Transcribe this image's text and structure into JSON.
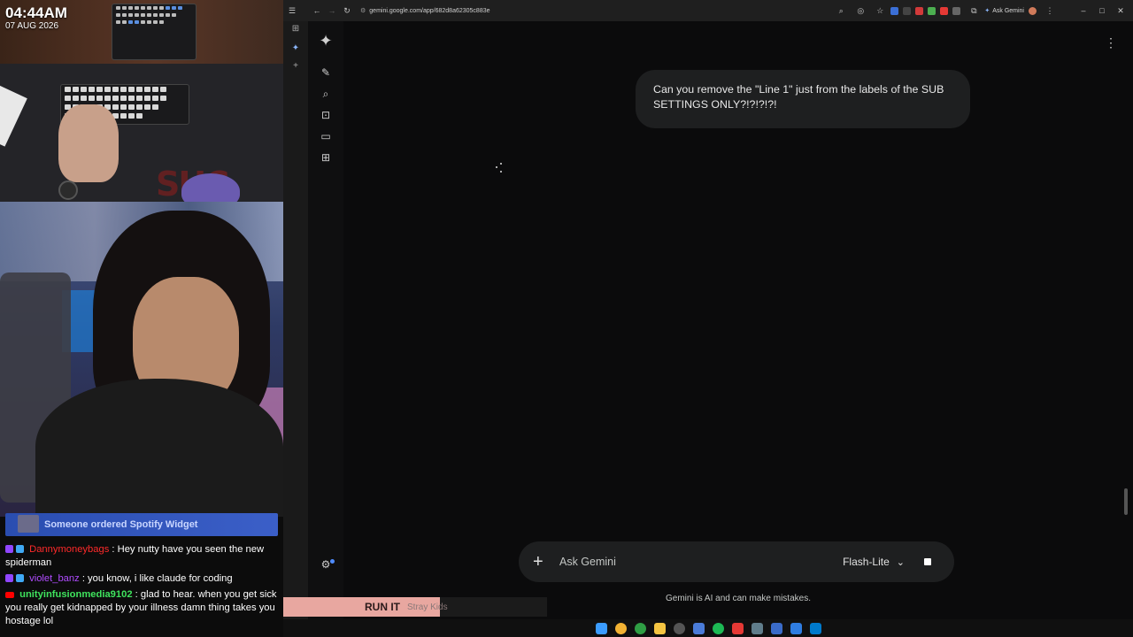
{
  "stream": {
    "clock": {
      "time": "04:44AM",
      "date": "07 AUG 2026"
    },
    "bg_text": "SHC",
    "notice": "Someone ordered Spotify Widget",
    "chat": [
      {
        "platform": "twitch",
        "user": "Dannymoneybags",
        "sep": " : ",
        "text": "Hey nutty have you seen the new spiderman"
      },
      {
        "platform": "twitch",
        "user": "violet_banz",
        "sep": " : ",
        "text": "you know, i like claude for coding"
      },
      {
        "platform": "youtube",
        "user": "unityinfusionmedia9102",
        "sep": " : ",
        "text": "glad to hear. when you get sick you really get kidnapped by your illness damn thing takes you hostage lol"
      }
    ],
    "now_playing": {
      "song": "RUN IT",
      "artist": "Stray Kids"
    }
  },
  "browser": {
    "url": "gemini.google.com/app/682d8a62305c883e",
    "ask_gemini_label": "Ask Gemini",
    "icons": [
      "sidebar-toggle-icon",
      "back-icon",
      "forward-icon",
      "reload-icon",
      "site-info-icon",
      "zoom-icon",
      "eye-off-icon",
      "star-icon",
      "extensions-icon",
      "menu-icon"
    ],
    "window_controls": {
      "minimize": "–",
      "maximize": "□",
      "close": "✕"
    }
  },
  "gemini": {
    "user_message": "Can you remove the \"Line 1\" just from the labels of the SUB SETTINGS ONLY?!?!?!?!",
    "composer_placeholder": "Ask Gemini",
    "model": "Flash-Lite",
    "disclaimer": "Gemini is AI and can make mistakes.",
    "accent": "#4f8cff",
    "sidebar_icons": [
      "gemini-spark-icon",
      "new-chat-icon",
      "search-icon",
      "gems-icon",
      "library-icon",
      "apps-icon",
      "settings-icon"
    ]
  },
  "taskbar": {
    "apps": [
      "start",
      "chrome-canary",
      "chrome",
      "file-explorer",
      "obs",
      "app-blue",
      "spotify",
      "app-red",
      "app-a",
      "app-dev",
      "app-tool",
      "vscode"
    ]
  }
}
